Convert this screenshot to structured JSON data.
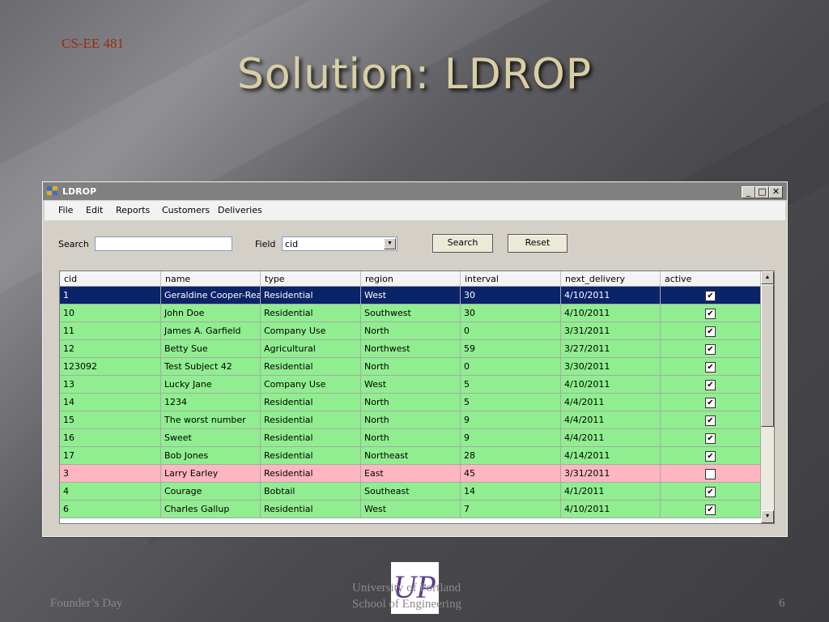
{
  "slide": {
    "course": "CS-EE 481",
    "title": "Solution: LDROP",
    "footer_left": "Founder’s Day",
    "footer_center_line1": "University of Portland",
    "footer_center_line2": "School of Engineering",
    "page_number": "6",
    "logo_text": "UP",
    "logo_color": "#5b3a8c"
  },
  "window": {
    "title": "LDROP",
    "minimize": "_",
    "maximize": "□",
    "close": "✕"
  },
  "menu": [
    "File",
    "Edit",
    "Reports",
    "Customers",
    "Deliveries"
  ],
  "search": {
    "label": "Search",
    "value": "",
    "field_label": "Field",
    "field_value": "cid",
    "search_button": "Search",
    "reset_button": "Reset"
  },
  "colors": {
    "selected_row": "#0a246a",
    "active_row": "#90ee90",
    "inactive_row": "#ffb6c1"
  },
  "grid": {
    "columns": [
      "cid",
      "name",
      "type",
      "region",
      "interval",
      "next_delivery",
      "active"
    ],
    "rows": [
      {
        "cid": "1",
        "name": "Geraldine Cooper-Rea...",
        "type": "Residential",
        "region": "West",
        "interval": "30",
        "next_delivery": "4/10/2011",
        "active": true,
        "selected": true
      },
      {
        "cid": "10",
        "name": "John Doe",
        "type": "Residential",
        "region": "Southwest",
        "interval": "30",
        "next_delivery": "4/10/2011",
        "active": true
      },
      {
        "cid": "11",
        "name": "James A. Garfield",
        "type": "Company Use",
        "region": "North",
        "interval": "0",
        "next_delivery": "3/31/2011",
        "active": true
      },
      {
        "cid": "12",
        "name": "Betty Sue",
        "type": "Agricultural",
        "region": "Northwest",
        "interval": "59",
        "next_delivery": "3/27/2011",
        "active": true
      },
      {
        "cid": "123092",
        "name": "Test Subject 42",
        "type": "Residential",
        "region": "North",
        "interval": "0",
        "next_delivery": "3/30/2011",
        "active": true
      },
      {
        "cid": "13",
        "name": "Lucky Jane",
        "type": "Company Use",
        "region": "West",
        "interval": "5",
        "next_delivery": "4/10/2011",
        "active": true
      },
      {
        "cid": "14",
        "name": "1234",
        "type": "Residential",
        "region": "North",
        "interval": "5",
        "next_delivery": "4/4/2011",
        "active": true
      },
      {
        "cid": "15",
        "name": "The worst number",
        "type": "Residential",
        "region": "North",
        "interval": "9",
        "next_delivery": "4/4/2011",
        "active": true
      },
      {
        "cid": "16",
        "name": "Sweet",
        "type": "Residential",
        "region": "North",
        "interval": "9",
        "next_delivery": "4/4/2011",
        "active": true
      },
      {
        "cid": "17",
        "name": "Bob Jones",
        "type": "Residential",
        "region": "Northeast",
        "interval": "28",
        "next_delivery": "4/14/2011",
        "active": true
      },
      {
        "cid": "3",
        "name": "Larry Earley",
        "type": "Residential",
        "region": "East",
        "interval": "45",
        "next_delivery": "3/31/2011",
        "active": false
      },
      {
        "cid": "4",
        "name": "Courage",
        "type": "Bobtail",
        "region": "Southeast",
        "interval": "14",
        "next_delivery": "4/1/2011",
        "active": true
      },
      {
        "cid": "6",
        "name": "Charles Gallup",
        "type": "Residential",
        "region": "West",
        "interval": "7",
        "next_delivery": "4/10/2011",
        "active": true
      }
    ]
  }
}
